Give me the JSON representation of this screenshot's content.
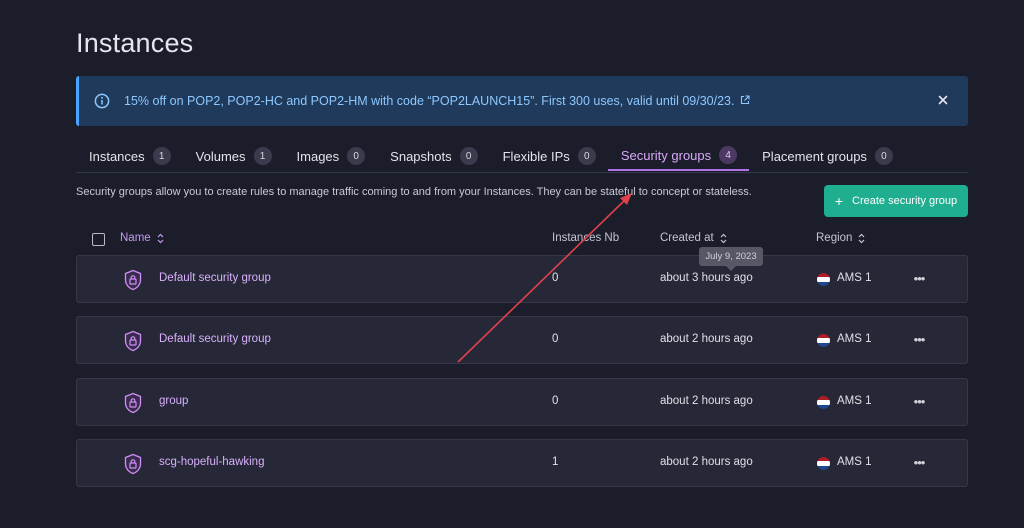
{
  "page": {
    "title": "Instances"
  },
  "banner": {
    "message": "15% off on POP2, POP2-HC and POP2-HM with code “POP2LAUNCH15”. First 300 uses, valid until 09/30/23.",
    "bg_color": "#1f3a5a",
    "text_color": "#8ec8ff",
    "icons": {
      "info": "info-icon",
      "external": "external-link-icon",
      "close": "close-icon"
    }
  },
  "tabs": [
    {
      "label": "Instances",
      "count": "1"
    },
    {
      "label": "Volumes",
      "count": "1"
    },
    {
      "label": "Images",
      "count": "0"
    },
    {
      "label": "Snapshots",
      "count": "0"
    },
    {
      "label": "Flexible IPs",
      "count": "0"
    },
    {
      "label": "Security groups",
      "count": "4",
      "active": true
    },
    {
      "label": "Placement groups",
      "count": "0"
    }
  ],
  "description": "Security groups allow you to create rules to manage traffic coming to and from your Instances. They can be stateful to concept or stateless.",
  "create_button": {
    "label": "Create security group",
    "icon": "plus-icon",
    "color": "#1fae90"
  },
  "table": {
    "columns": {
      "name": "Name",
      "instances": "Instances Nb",
      "created": "Created at",
      "region": "Region"
    },
    "rows": [
      {
        "name": "Default security group",
        "instances": "0",
        "created": "about 3 hours ago",
        "region": "AMS 1",
        "flag": "netherlands-flag-icon"
      },
      {
        "name": "Default security group",
        "instances": "0",
        "created": "about 2 hours ago",
        "region": "AMS 1",
        "flag": "netherlands-flag-icon"
      },
      {
        "name": "group",
        "instances": "0",
        "created": "about 2 hours ago",
        "region": "AMS 1",
        "flag": "netherlands-flag-icon"
      },
      {
        "name": "scg-hopeful-hawking",
        "instances": "1",
        "created": "about 2 hours ago",
        "region": "AMS 1",
        "flag": "netherlands-flag-icon"
      }
    ]
  },
  "tooltip": {
    "text": "July 9, 2023"
  },
  "colors": {
    "background": "#1c1d2b",
    "accent": "#b072e6",
    "row_bg": "#262838",
    "annotation_arrow": "#e0414a"
  }
}
